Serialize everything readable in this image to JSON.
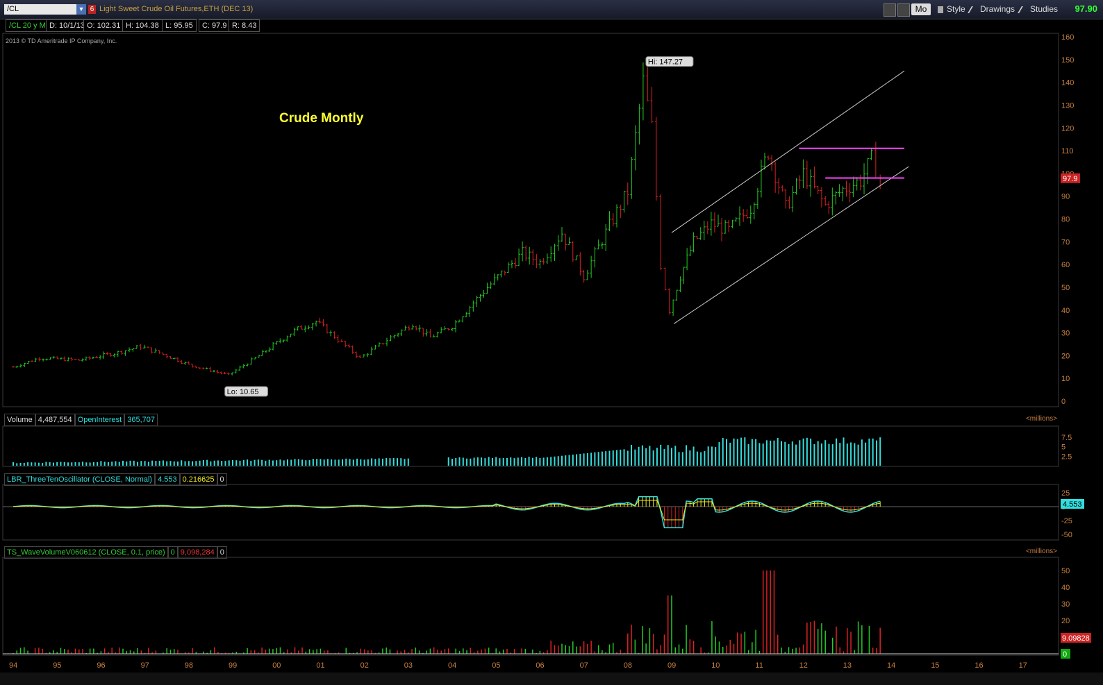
{
  "toolbar": {
    "symbol": "/CL",
    "dropdown_glyph": "▼",
    "period_badge": "6",
    "description": "Light Sweet Crude Oil Futures,ETH (DEC 13)",
    "mo_label": "Mo",
    "style_label": "Style",
    "drawings_label": "Drawings",
    "studies_label": "Studies",
    "last_price": "97.90"
  },
  "status": {
    "symbol_period": "/CL 20 y M",
    "date": "D: 10/1/13",
    "open": "O: 102.31",
    "high": "H: 104.38",
    "low": "L: 95.95",
    "close": "C: 97.9",
    "range": "R: 8.43"
  },
  "copyright": "2013 © TD Ameritrade IP Company, Inc.",
  "annotation": "Crude Montly",
  "chart_data": {
    "type": "ohlc",
    "price_ylim": [
      0,
      160
    ],
    "price_ticks": [
      0,
      10,
      20,
      30,
      40,
      50,
      60,
      70,
      80,
      90,
      100,
      110,
      120,
      130,
      140,
      150,
      160
    ],
    "x_labels": [
      "94",
      "95",
      "96",
      "97",
      "98",
      "99",
      "00",
      "01",
      "02",
      "03",
      "04",
      "05",
      "06",
      "07",
      "08",
      "09",
      "10",
      "11",
      "12",
      "13",
      "14",
      "15",
      "16",
      "17"
    ],
    "high_label": "Hi: 147.27",
    "low_label": "Lo: 10.65",
    "price_tag": "97.9",
    "anchors": [
      [
        1994.0,
        15
      ],
      [
        1994.6,
        19
      ],
      [
        1995.5,
        18
      ],
      [
        1996.3,
        21
      ],
      [
        1996.9,
        24
      ],
      [
        1997.5,
        20
      ],
      [
        1998.0,
        16
      ],
      [
        1998.9,
        11.5
      ],
      [
        1999.6,
        20
      ],
      [
        2000.4,
        31
      ],
      [
        2000.9,
        35
      ],
      [
        2001.9,
        19
      ],
      [
        2002.6,
        28
      ],
      [
        2003.1,
        34
      ],
      [
        2003.5,
        28
      ],
      [
        2004.0,
        33
      ],
      [
        2004.8,
        50
      ],
      [
        2005.6,
        65
      ],
      [
        2006.0,
        61
      ],
      [
        2006.5,
        74
      ],
      [
        2007.0,
        55
      ],
      [
        2007.5,
        74
      ],
      [
        2008.0,
        92
      ],
      [
        2008.35,
        140
      ],
      [
        2008.55,
        120
      ],
      [
        2008.75,
        60
      ],
      [
        2008.95,
        40
      ],
      [
        2009.2,
        55
      ],
      [
        2009.5,
        70
      ],
      [
        2009.9,
        78
      ],
      [
        2010.3,
        75
      ],
      [
        2010.8,
        85
      ],
      [
        2011.2,
        110
      ],
      [
        2011.6,
        85
      ],
      [
        2012.0,
        100
      ],
      [
        2012.5,
        86
      ],
      [
        2012.9,
        93
      ],
      [
        2013.3,
        97
      ],
      [
        2013.55,
        106
      ],
      [
        2013.75,
        98
      ]
    ],
    "trend_lines": [
      {
        "from": [
          2009.0,
          74
        ],
        "to": [
          2014.3,
          145
        ],
        "color": "#cccccc"
      },
      {
        "from": [
          2009.05,
          34
        ],
        "to": [
          2014.4,
          103
        ],
        "color": "#cccccc"
      },
      {
        "from": [
          2011.9,
          111
        ],
        "to": [
          2014.3,
          111
        ],
        "color": "#ff44ff"
      },
      {
        "from": [
          2012.5,
          98
        ],
        "to": [
          2014.3,
          98
        ],
        "color": "#ff44ff"
      }
    ],
    "volume": {
      "label": "Volume",
      "value": "4,487,554",
      "oi_label": "OpenInterest",
      "oi_value": "365,707",
      "units": "<millions>",
      "ticks": [
        "7.5",
        "5",
        "2.5"
      ],
      "ylim": [
        0,
        10
      ]
    },
    "oscillator": {
      "name": "LBR_ThreeTenOscillator (CLOSE, Normal)",
      "value1": "4.553",
      "value2": "0.216625",
      "value3": "0",
      "ticks": [
        "25",
        "0",
        "-25",
        "-50"
      ],
      "tag": "4.553"
    },
    "wave_volume": {
      "name": "TS_WaveVolumeV060612 (CLOSE, 0.1, price)",
      "value1": "0",
      "value2": "9,098,284",
      "value3": "0",
      "units": "<millions>",
      "ticks": [
        "50",
        "40",
        "30",
        "20",
        "10"
      ],
      "tag_red": "9.09828",
      "tag_green": "0"
    }
  },
  "colors": {
    "up": "#22cc22",
    "down": "#dd2222",
    "grid": "#333333",
    "cyan": "#33dddd",
    "yellow": "#eeee22",
    "magenta": "#ff44ff"
  }
}
